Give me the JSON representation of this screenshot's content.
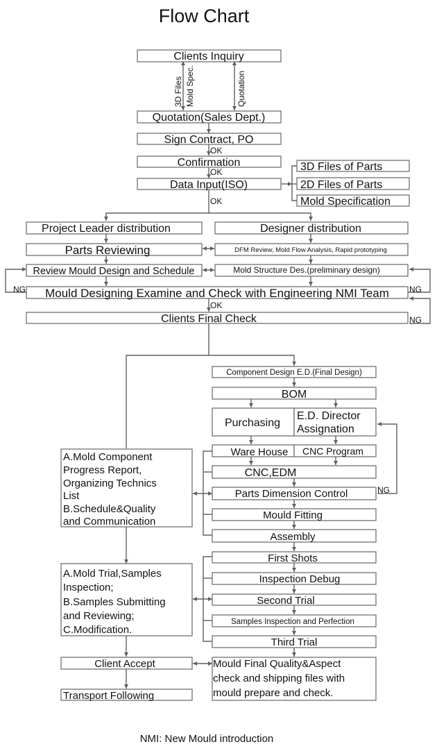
{
  "title": "Flow Chart",
  "footnote": "NMI: New Mould introduction",
  "nodes": {
    "clients_inquiry": "Clients Inquiry",
    "quotation_sales": "Quotation(Sales Dept.)",
    "sign_contract": "Sign Contract, PO",
    "confirmation": "Confirmation",
    "data_input": "Data Input(ISO)",
    "files_3d": "3D Files of Parts",
    "files_2d": "2D Files of Parts",
    "mold_spec": "Mold Specification",
    "project_leader": "Project Leader distribution",
    "designer_dist": "Designer distribution",
    "parts_reviewing": "Parts Reviewing",
    "dfm_review": "DFM Review, Mold Flow Analysis, Rapid prototyping",
    "review_mould": "Review Mould Design and Schedule",
    "mold_structure": "Mold Structure Des.(preliminary design)",
    "mould_examine": "Mould Designing Examine and Check with Engineering NMI Team",
    "clients_final": "Clients Final Check",
    "component_design": "Component Design E.D.(Final Design)",
    "bom": "BOM",
    "purchasing": "Purchasing",
    "ed_director_1": "E.D. Director",
    "ed_director_2": "Assignation",
    "ware_house": "Ware House",
    "cnc_program": "CNC Program",
    "cnc_edm": "CNC,EDM",
    "parts_dimension": "Parts Dimension Control",
    "mould_fitting": "Mould Fitting",
    "assembly": "Assembly",
    "first_shots": "First Shots",
    "inspection_debug": "Inspection Debug",
    "second_trial": "Second Trial",
    "samples_inspection": "Samples Inspection and Perfection",
    "third_trial": "Third Trial",
    "progress_report": [
      "A.Mold Component",
      "Progress Report,",
      "Organizing Technics",
      "List",
      "B.Schedule&Quality",
      "and Communication"
    ],
    "mold_trial": [
      "A.Mold Trial,Samples",
      "Inspection;",
      "B.Samples Submitting",
      "and Reviewing;",
      "C.Modification."
    ],
    "client_accept": "Client Accept",
    "transport": "Transport Following",
    "final_quality": [
      "Mould Final Quality&Aspect",
      "check and shipping files with",
      "mould prepare and check."
    ]
  },
  "edge_labels": {
    "files_3d": "3D Files",
    "mold_spec": "Mold Spec.",
    "quotation": "Quotation",
    "ok": "OK",
    "ng": "NG"
  }
}
